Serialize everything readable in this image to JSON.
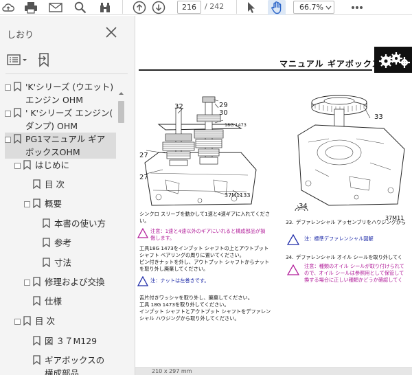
{
  "toolbar": {
    "page_current": "216",
    "page_total": "/ 242",
    "zoom": "66.7%"
  },
  "sidebar": {
    "title": "しおり",
    "items": [
      {
        "label": "'K'シリーズ (ウエット)\nエンジン OHM"
      },
      {
        "label": "' K'シリーズ エンジン(\nダンプ) OHM"
      },
      {
        "label": "PG1マニュアル ギア\nボックスOHM"
      },
      {
        "label": "はじめに"
      },
      {
        "label": "目 次"
      },
      {
        "label": "概要"
      },
      {
        "label": "本書の使い方"
      },
      {
        "label": "参考"
      },
      {
        "label": "寸法"
      },
      {
        "label": "修理および交換"
      },
      {
        "label": "仕様"
      },
      {
        "label": "目 次"
      },
      {
        "label": "図 ３７M129"
      },
      {
        "label": "ギアボックスの\n構成部品"
      }
    ]
  },
  "document": {
    "header_title": "マニュアル ギアボックス",
    "fig_left": {
      "callout_32": "32",
      "callout_29": "29",
      "callout_30": "30",
      "tool": "18G 1473",
      "callout_27a": "27",
      "callout_27b": "27",
      "code": "37M1133"
    },
    "fig_right": {
      "callout_33": "33",
      "callout_34": "34",
      "code": "37M11"
    },
    "left_text_1": "シンクロ スリーブを動かして1速と4速ギアに入れてください。",
    "left_warn_1": "注意：1速と4速以外のギアにいれると構成部品が損\n傷します。",
    "left_text_2": "工具18G 1473をインプット シャフトの上とアウトプット\nシャフト ベアリングの周りに置いてください。\nピン付きナットを外し、アウトプット シャフトからナット\nを取り外し廃棄してください。",
    "left_note": "注：ナットは左巻きです。",
    "left_text_3": "舌片付きワッシャを取り外し、廃棄してください。\n工具 18G 1473を取り外してください。\nインプット シャフトとアウトプット シャフトをデファレン\nシャル ハウジングから取り外してください。",
    "right_num_33": "33.",
    "right_text_33": "デファレンシャル アッセンブリをハウジングから",
    "right_note": "注：標準デファレンシャル図解",
    "right_num_34": "34.",
    "right_text_34": "デファレンシャル オイル シールを取り外してく",
    "right_warn": "注意：種類のオイル シールが取り付けられて\nので、オイル シールは参照用として保管して\n換する場合に正しい種類かどうか確認してく",
    "status": "210 x 297 mm"
  }
}
